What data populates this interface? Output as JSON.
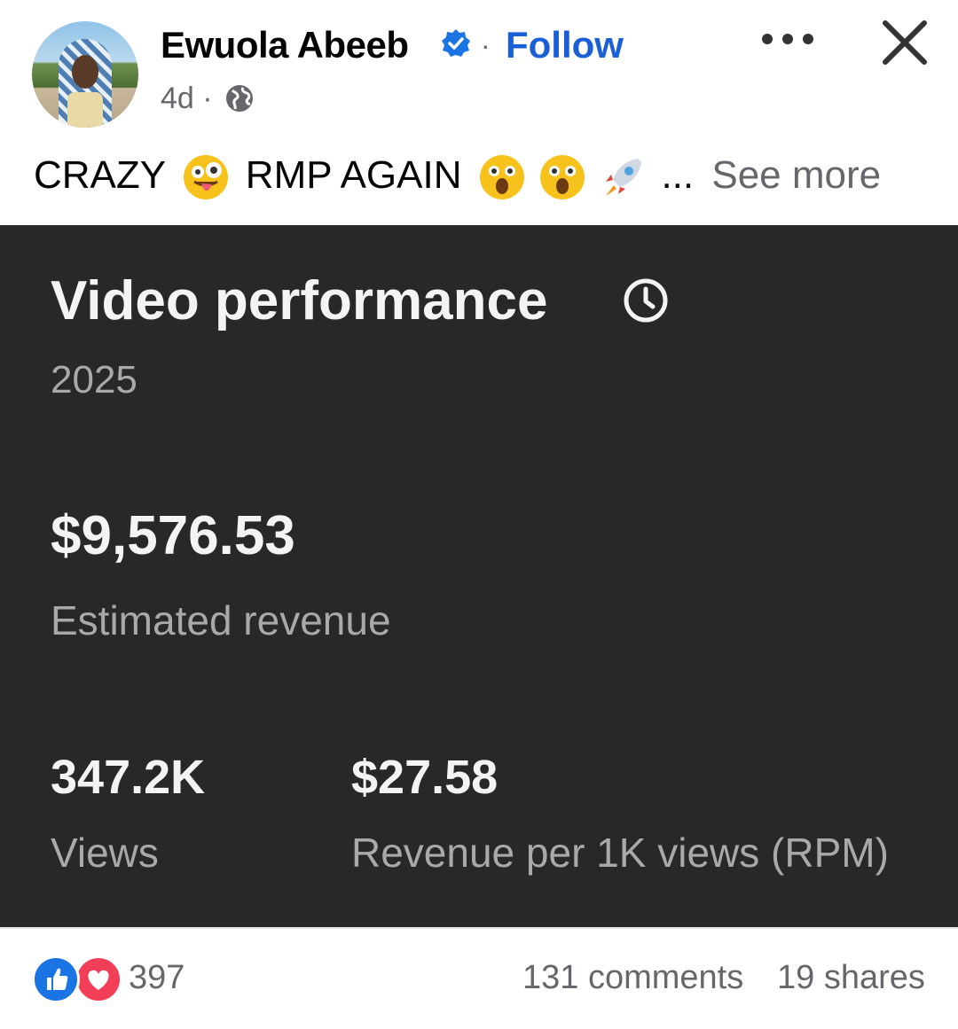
{
  "post": {
    "author": "Ewuola Abeeb",
    "separator": "·",
    "follow_label": "Follow",
    "age": "4d ·",
    "privacy_icon": "globe-icon",
    "caption_parts": [
      "CRAZY",
      "RMP AGAIN",
      "..."
    ],
    "caption_emojis": [
      "zany-face-icon",
      "astonished-face-icon",
      "astonished-face-icon",
      "rocket-icon"
    ],
    "see_more_label": "See more"
  },
  "card": {
    "title": "Video performance",
    "year": "2025",
    "revenue_value": "$9,576.53",
    "revenue_label": "Estimated revenue",
    "views_value": "347.2K",
    "views_label": "Views",
    "rpm_value": "$27.58",
    "rpm_label": "Revenue per 1K views (RPM)"
  },
  "footer": {
    "reactions_count": "397",
    "comments": "131 comments",
    "shares": "19 shares"
  },
  "colors": {
    "accent": "#1b5fd6",
    "card_bg": "#282828",
    "secondary_text": "#65676b"
  }
}
